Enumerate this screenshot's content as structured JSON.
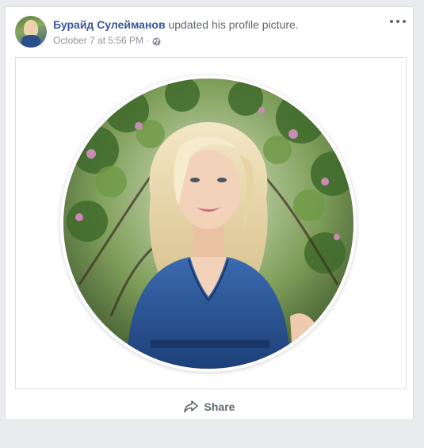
{
  "post": {
    "author": "Бурайд Сулейманов",
    "action": "updated his profile picture.",
    "timestamp": "October 7 at 5:56 PM",
    "separator": "·",
    "privacy_icon": "globe-icon",
    "more_icon": "more-options-icon"
  },
  "actions": {
    "share_label": "Share",
    "share_icon": "share-arrow-icon"
  },
  "colors": {
    "author_link": "#365899",
    "page_background": "#e9ebee",
    "secondary_text": "#90949c"
  }
}
